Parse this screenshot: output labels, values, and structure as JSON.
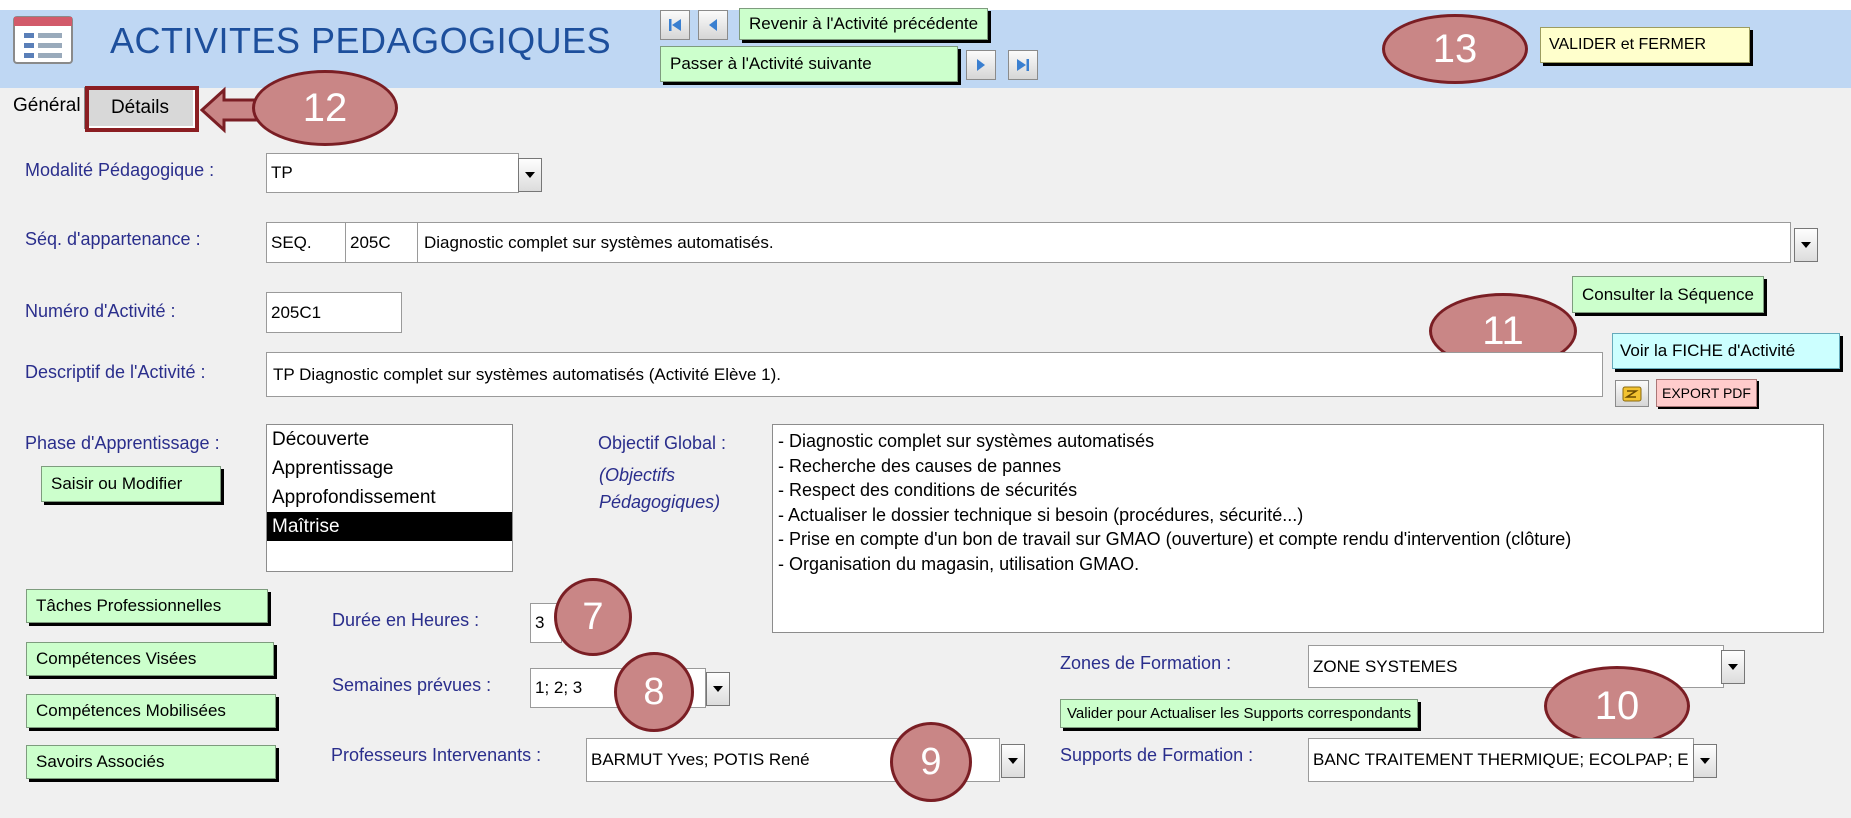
{
  "header": {
    "title": "ACTIVITES PEDAGOGIQUES",
    "prev_activity": "Revenir à l'Activité précédente",
    "next_activity": "Passer à l'Activité suivante",
    "validate_close": "VALIDER et FERMER"
  },
  "tabs": {
    "general": "Général",
    "details": "Détails"
  },
  "fields": {
    "modalite_label": "Modalité Pédagogique :",
    "modalite_value": "TP",
    "seq_label": "Séq. d'appartenance :",
    "seq_prefix": "SEQ.",
    "seq_code": "205C",
    "seq_title": "Diagnostic complet sur systèmes automatisés.",
    "numero_label": "Numéro d'Activité :",
    "numero_value": "205C1",
    "descriptif_label": "Descriptif de l'Activité :",
    "descriptif_value": "TP Diagnostic complet sur systèmes automatisés  (Activité Elève 1).",
    "phase_label": "Phase d'Apprentissage :",
    "objectif_label": "Objectif Global :",
    "objectif_sub1": "(Objectifs",
    "objectif_sub2": "Pédagogiques)",
    "duree_label": "Durée en Heures :",
    "duree_value": "3",
    "semaines_label": "Semaines prévues :",
    "semaines_value": "1; 2; 3",
    "profs_label": "Professeurs Intervenants :",
    "profs_value": "BARMUT Yves; POTIS René",
    "zones_label": "Zones de Formation :",
    "zones_value": "ZONE SYSTEMES",
    "supports_label": "Supports de Formation :",
    "supports_value": "BANC TRAITEMENT THERMIQUE; ECOLPAP; E"
  },
  "phases": [
    {
      "label": "Découverte",
      "selected": false
    },
    {
      "label": "Apprentissage",
      "selected": false
    },
    {
      "label": "Approfondissement",
      "selected": false
    },
    {
      "label": "Maîtrise",
      "selected": true
    }
  ],
  "objectives": [
    "- Diagnostic complet sur systèmes automatisés",
    "- Recherche des causes de pannes",
    "- Respect des conditions de sécurités",
    "- Actualiser le dossier technique si besoin (procédures, sécurité...)",
    "- Prise en compte d'un bon de travail sur GMAO (ouverture) et compte rendu d'intervention (clôture)",
    "- Organisation du magasin, utilisation GMAO."
  ],
  "buttons": {
    "consulter_sequence": "Consulter la Séquence",
    "voir_fiche": "Voir la FICHE d'Activité",
    "export_pdf": "EXPORT PDF",
    "saisir_modifier": "Saisir ou Modifier",
    "taches": "Tâches Professionnelles",
    "competences_visees": "Compétences Visées",
    "competences_mobilisees": "Compétences Mobilisées",
    "savoirs": "Savoirs Associés",
    "valider_supports": "Valider pour Actualiser les Supports correspondants"
  },
  "callouts": {
    "c7": "7",
    "c8": "8",
    "c9": "9",
    "c10": "10",
    "c11": "11",
    "c12": "12",
    "c13": "13"
  },
  "colors": {
    "header_bg": "#bfd7f3",
    "green_button": "#ccffcc",
    "callout_fill": "#c98686",
    "callout_border": "#7a1e24"
  }
}
